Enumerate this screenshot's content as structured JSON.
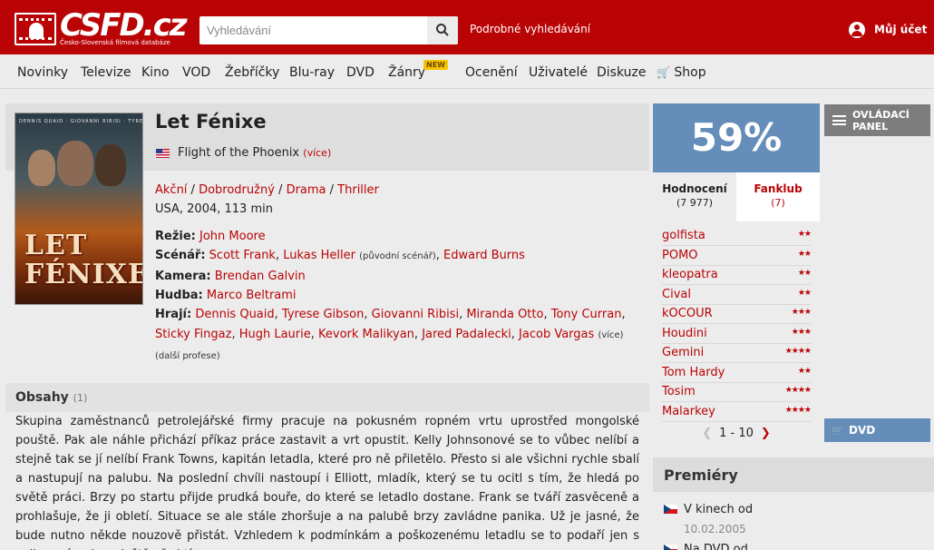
{
  "header": {
    "logo_text": "CSFD.cz",
    "logo_subtitle": "Česko-Slovenská filmová databáze",
    "search_placeholder": "Vyhledávání",
    "advanced_search": "Podrobné vyhledávání",
    "account": "Můj účet"
  },
  "nav": {
    "items": [
      "Novinky",
      "Televize",
      "Kino",
      "VOD",
      "Žebříčky",
      "Blu-ray",
      "DVD",
      "Žánry",
      "Ocenění",
      "Uživatelé",
      "Diskuze",
      "Shop"
    ],
    "new_badge": "NEW",
    "cart_icon": "cart-icon"
  },
  "film": {
    "title": "Let Fénixe",
    "original_title": "Flight of the Phoenix",
    "original_more": "(více)",
    "genres": [
      "Akční",
      "Dobrodružný",
      "Drama",
      "Thriller"
    ],
    "genre_sep": " / ",
    "origin": "USA, 2004, 113 min",
    "poster_title": "LET FÉNIXE",
    "directing_label": "Režie:",
    "director": "John Moore",
    "screenplay_label": "Scénář:",
    "screenplay_1": "Scott Frank",
    "screenplay_2": "Lukas Heller",
    "screenplay_note": "(původní scénář)",
    "screenplay_3": "Edward Burns",
    "camera_label": "Kamera:",
    "camera": "Brendan Galvin",
    "music_label": "Hudba:",
    "music": "Marco Beltrami",
    "cast_label": "Hrají:",
    "cast_line1": [
      "Dennis Quaid",
      "Tyrese Gibson",
      "Giovanni Ribisi",
      "Miranda Otto",
      "Tony Curran"
    ],
    "cast_line2": [
      "Sticky Fingaz",
      "Hugh Laurie",
      "Kevork Malikyan",
      "Jared Padalecki",
      "Jacob Vargas"
    ],
    "cast_more": "(více)",
    "more_professions": "(další profese)"
  },
  "plot": {
    "title": "Obsahy",
    "count": "(1)",
    "text": "Skupina zaměstnanců petrolejářské firmy pracuje na pokusném ropném vrtu uprostřed mongolské pouště. Pak ale náhle přichází příkaz práce zastavit a vrt opustit. Kelly Johnsonové se to vůbec nelíbí a stejně tak se jí nelíbí Frank Towns, kapitán letadla, které pro ně přiletělo. Přesto si ale všichni rychle sbalí a nastupují na palubu. Na poslední chvíli nastoupí i Elliott, mladík, který se tu ocitl s tím, že hledá po světě práci. Brzy po startu přijde prudká bouře, do které se letadlo dostane. Frank se tváří zasvěceně a prohlašuje, že ji obletí. Situace se ale stále zhoršuje a na palubě brzy zavládne panika. Už je jasné, že bude nutno někde nouzově přistát. Vzhledem k podmínkám a poškozenému letadlu se to podaří jen s velkou námahou. Ještě před tím"
  },
  "rating": {
    "percent": "59%",
    "tab_ratings": "Hodnocení",
    "tab_ratings_count": "(7 977)",
    "tab_fanclub": "Fanklub",
    "tab_fanclub_count": "(7)",
    "users": [
      {
        "name": "golfista",
        "stars": 2
      },
      {
        "name": "POMO",
        "stars": 2
      },
      {
        "name": "kleopatra",
        "stars": 2
      },
      {
        "name": "Cival",
        "stars": 2
      },
      {
        "name": "kOCOUR",
        "stars": 3
      },
      {
        "name": "Houdini",
        "stars": 3
      },
      {
        "name": "Gemini",
        "stars": 4
      },
      {
        "name": "Tom Hardy",
        "stars": 2
      },
      {
        "name": "Tosim",
        "stars": 4
      },
      {
        "name": "Malarkey",
        "stars": 4
      }
    ],
    "pager": "1 - 10",
    "brand_color": "#ba0305",
    "rating_color": "#658db9"
  },
  "premieres": {
    "title": "Premiéry",
    "cinema_label": "V kinech od",
    "cinema_date": "10.02.2005",
    "dvd_label": "Na DVD od"
  },
  "side": {
    "panel_label_1": "OVLÁDACÍ",
    "panel_label_2": "PANEL",
    "dvd_label": "DVD"
  }
}
